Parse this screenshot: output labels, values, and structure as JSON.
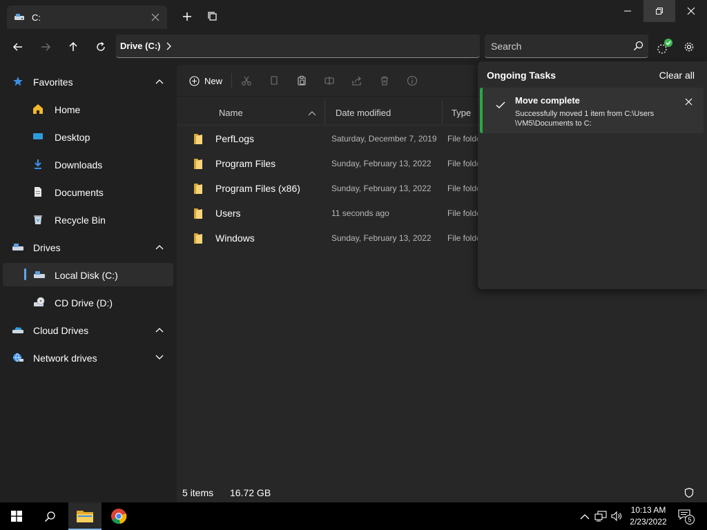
{
  "tab": {
    "title": "C:"
  },
  "address": {
    "crumb": "Drive (C:)"
  },
  "search": {
    "placeholder": "Search"
  },
  "sidebar": {
    "favorites": {
      "label": "Favorites"
    },
    "items": [
      {
        "label": "Home",
        "icon": "home-icon"
      },
      {
        "label": "Desktop",
        "icon": "desktop-icon"
      },
      {
        "label": "Downloads",
        "icon": "downloads-icon"
      },
      {
        "label": "Documents",
        "icon": "documents-icon"
      },
      {
        "label": "Recycle Bin",
        "icon": "recycle-bin-icon"
      }
    ],
    "drives": {
      "label": "Drives"
    },
    "drive_items": [
      {
        "label": "Local Disk (C:)",
        "icon": "hard-drive-icon"
      },
      {
        "label": "CD Drive (D:)",
        "icon": "cd-drive-icon"
      }
    ],
    "cloud": {
      "label": "Cloud Drives"
    },
    "network": {
      "label": "Network drives"
    }
  },
  "toolbar": {
    "new_label": "New"
  },
  "columns": {
    "name": "Name",
    "date": "Date modified",
    "type": "Type"
  },
  "files": [
    {
      "name": "PerfLogs",
      "date": "Saturday, December 7, 2019",
      "type": "File folder"
    },
    {
      "name": "Program Files",
      "date": "Sunday, February 13, 2022",
      "type": "File folder"
    },
    {
      "name": "Program Files (x86)",
      "date": "Sunday, February 13, 2022",
      "type": "File folder"
    },
    {
      "name": "Users",
      "date": "11 seconds ago",
      "type": "File folder"
    },
    {
      "name": "Windows",
      "date": "Sunday, February 13, 2022",
      "type": "File folder"
    }
  ],
  "status": {
    "count": "5 items",
    "size": "16.72 GB"
  },
  "tasks": {
    "title": "Ongoing Tasks",
    "clear_label": "Clear all",
    "item": {
      "title": "Move complete",
      "line1": "Successfully moved 1 item from C:\\Users",
      "line2": "\\VM5\\Documents to C:"
    }
  },
  "clock": {
    "time": "10:13 AM",
    "date": "2/23/2022"
  },
  "notifications": {
    "count": "5"
  },
  "colors": {
    "accent": "#60a5f0",
    "success": "#28a745",
    "folder": "#f2c94c"
  }
}
